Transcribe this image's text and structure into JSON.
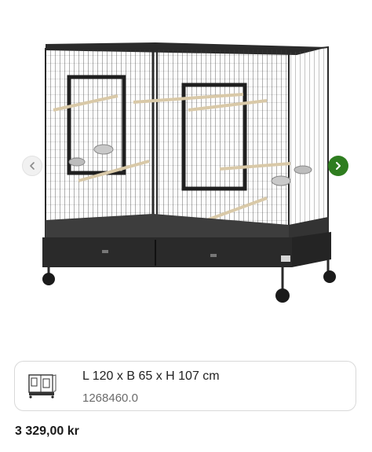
{
  "gallery": {
    "image_alt": "bird-cage-image",
    "prev_icon": "chevron-left-icon",
    "next_icon": "chevron-right-icon",
    "next_color": "#2e7d1f"
  },
  "variant": {
    "title": "L 120 x B 65 x H 107 cm",
    "sku": "1268460.0"
  },
  "price": "3 329,00 kr"
}
